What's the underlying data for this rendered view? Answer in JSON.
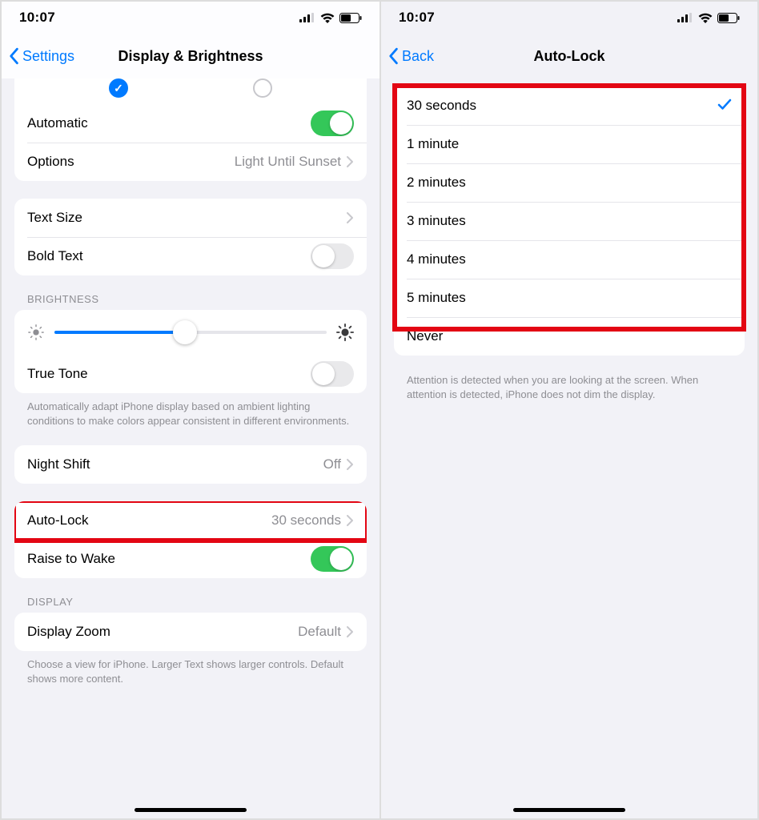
{
  "left": {
    "status_time": "10:07",
    "nav_back": "Settings",
    "nav_title": "Display & Brightness",
    "appearance_selected_index": 0,
    "automatic_label": "Automatic",
    "automatic_on": true,
    "options_label": "Options",
    "options_value": "Light Until Sunset",
    "text_size_label": "Text Size",
    "bold_text_label": "Bold Text",
    "bold_text_on": false,
    "brightness_header": "BRIGHTNESS",
    "brightness_percent": 48,
    "true_tone_label": "True Tone",
    "true_tone_on": false,
    "true_tone_footer": "Automatically adapt iPhone display based on ambient lighting conditions to make colors appear consistent in different environments.",
    "night_shift_label": "Night Shift",
    "night_shift_value": "Off",
    "auto_lock_label": "Auto-Lock",
    "auto_lock_value": "30 seconds",
    "raise_to_wake_label": "Raise to Wake",
    "raise_to_wake_on": true,
    "display_header": "DISPLAY",
    "display_zoom_label": "Display Zoom",
    "display_zoom_value": "Default",
    "display_zoom_footer": "Choose a view for iPhone. Larger Text shows larger controls. Default shows more content."
  },
  "right": {
    "status_time": "10:07",
    "nav_back": "Back",
    "nav_title": "Auto-Lock",
    "options": [
      "30 seconds",
      "1 minute",
      "2 minutes",
      "3 minutes",
      "4 minutes",
      "5 minutes",
      "Never"
    ],
    "selected_index": 0,
    "footer": "Attention is detected when you are looking at the screen. When attention is detected, iPhone does not dim the display."
  }
}
